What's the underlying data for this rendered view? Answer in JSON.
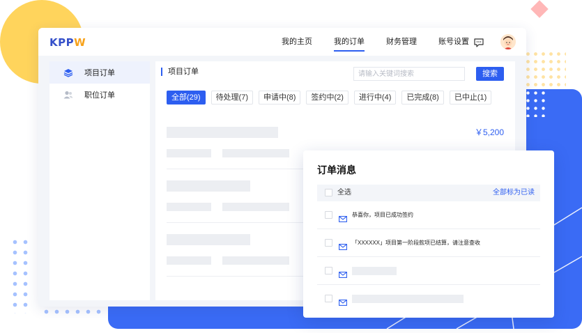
{
  "brand": {
    "logo_kpp": "KPP",
    "logo_w": "W"
  },
  "nav": {
    "items": [
      {
        "label": "我的主页"
      },
      {
        "label": "我的订单"
      },
      {
        "label": "财务管理"
      },
      {
        "label": "账号设置"
      }
    ],
    "active_index": 1
  },
  "sidebar": {
    "items": [
      {
        "label": "项目订单",
        "icon": "layers-icon"
      },
      {
        "label": "职位订单",
        "icon": "users-icon"
      }
    ]
  },
  "content": {
    "title": "项目订单",
    "search_placeholder": "请输入关键词搜索",
    "search_button": "搜索",
    "tabs": [
      {
        "label": "全部(29)"
      },
      {
        "label": "待处理(7)"
      },
      {
        "label": "申请中(8)"
      },
      {
        "label": "签约中(2)"
      },
      {
        "label": "进行中(4)"
      },
      {
        "label": "已完成(8)"
      },
      {
        "label": "已中止(1)"
      }
    ],
    "first_price": "￥5,200"
  },
  "popup": {
    "title": "订单消息",
    "select_all": "全选",
    "mark_all_read": "全部标为已读",
    "messages": [
      {
        "text": "恭喜你，项目已成功签约"
      },
      {
        "text": "「XXXXXX」项目第一阶段款项已结算，请注意查收"
      }
    ]
  },
  "colors": {
    "accent": "#2d5ef0",
    "panel_blue": "#3a6bf5",
    "decor_yellow": "#ffd45c",
    "decor_pink": "#ffb7b7",
    "logo_blue": "#3550c9",
    "logo_orange": "#f7a21b"
  }
}
